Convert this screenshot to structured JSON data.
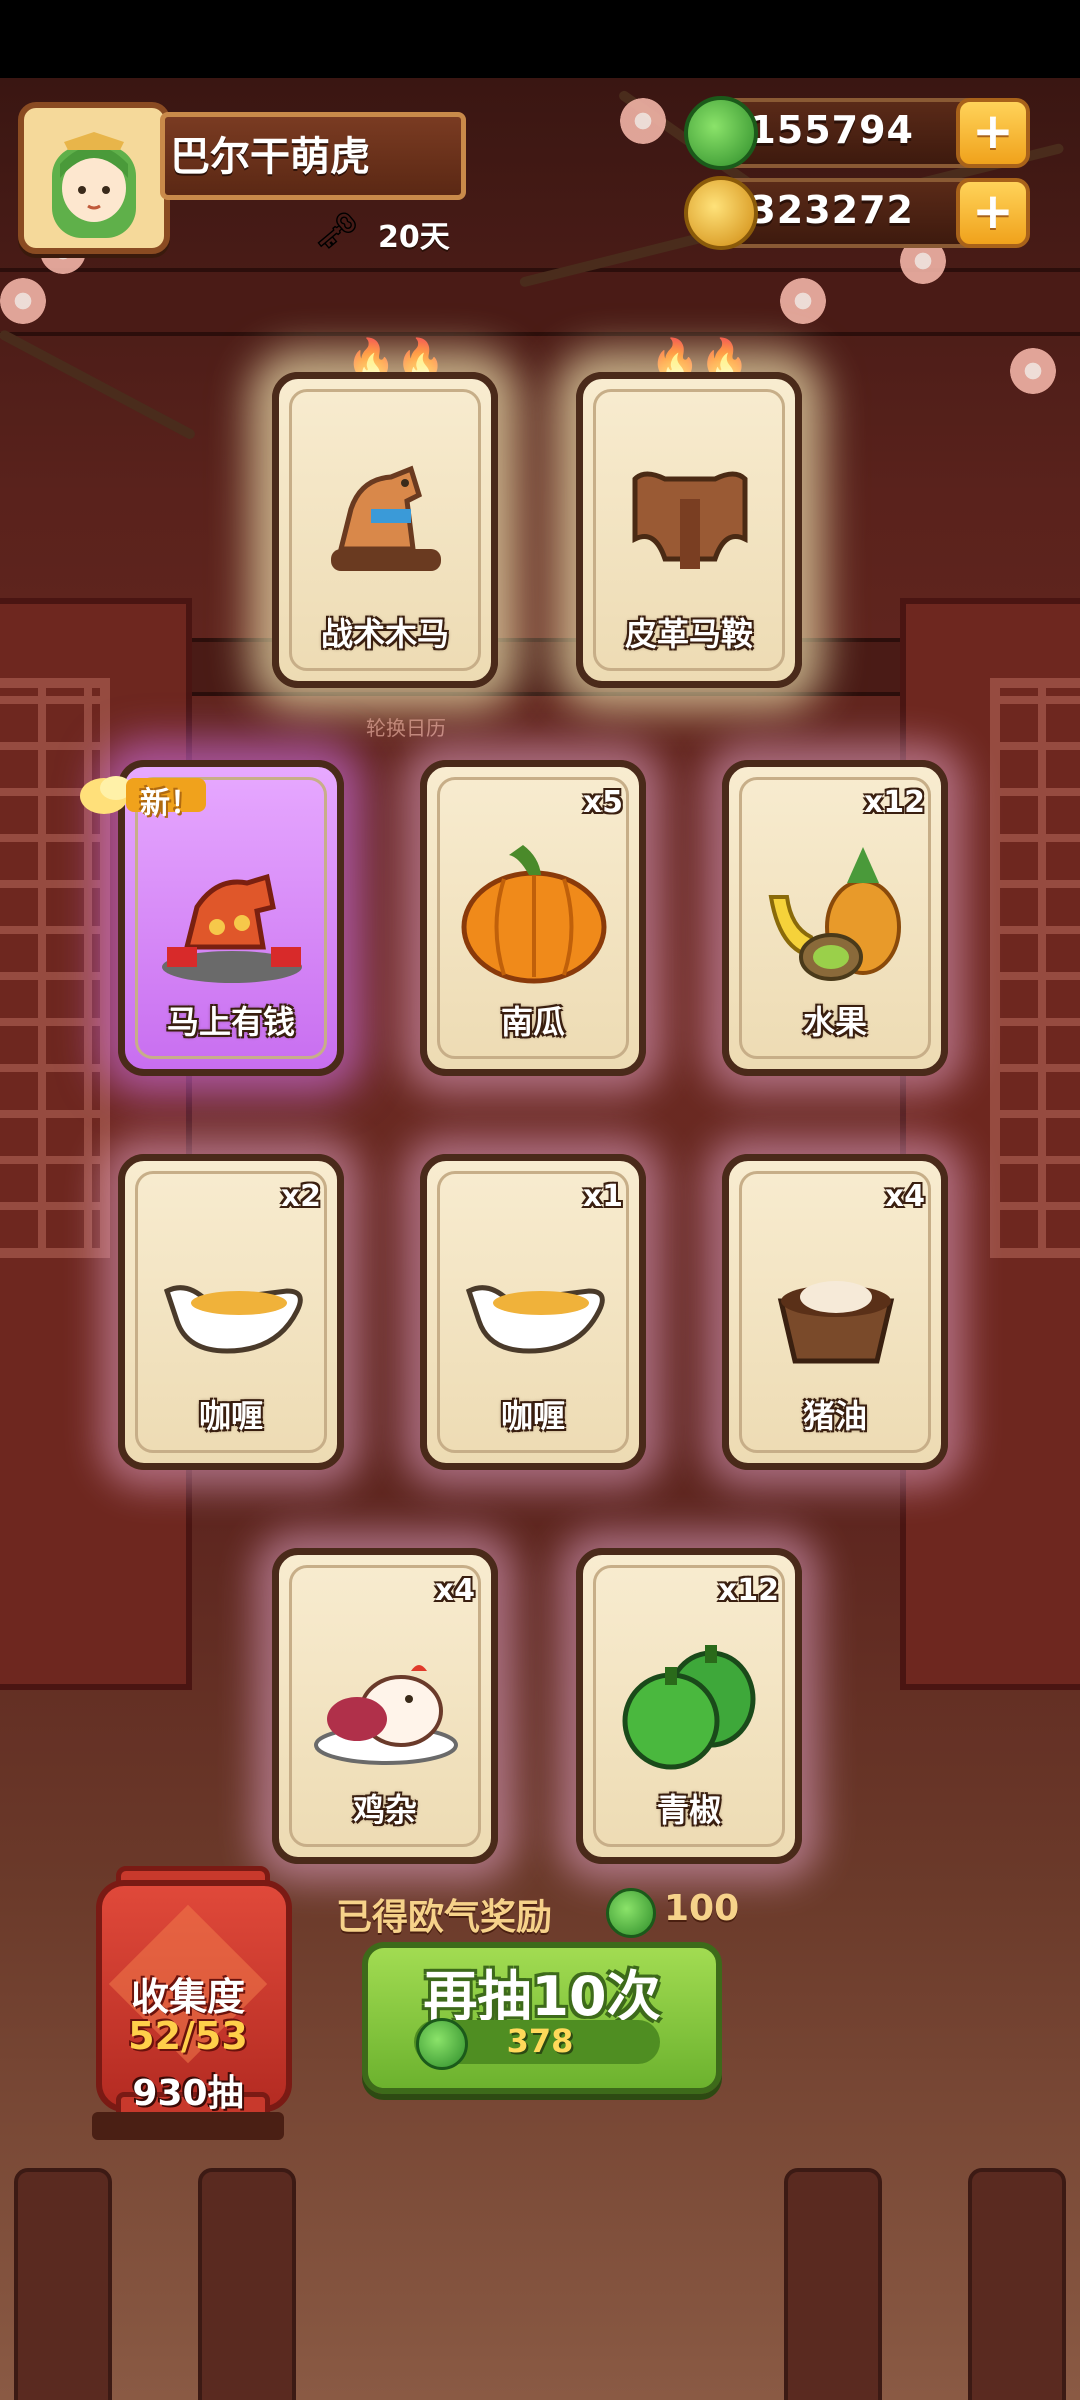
{
  "player": {
    "name": "巴尔干萌虎",
    "days": "20天"
  },
  "currencies": {
    "jade": "155794",
    "coins": "10323272"
  },
  "banner_label": "轮换日历",
  "cards": [
    {
      "name": "战术木马",
      "count": "",
      "rarity": "hot"
    },
    {
      "name": "皮革马鞍",
      "count": "",
      "rarity": "hot"
    },
    {
      "name": "马上有钱",
      "count": "",
      "rarity": "new"
    },
    {
      "name": "南瓜",
      "count": "x5"
    },
    {
      "name": "水果",
      "count": "x12"
    },
    {
      "name": "咖喱",
      "count": "x2"
    },
    {
      "name": "咖喱",
      "count": "x1"
    },
    {
      "name": "猪油",
      "count": "x4"
    },
    {
      "name": "鸡杂",
      "count": "x4"
    },
    {
      "name": "青椒",
      "count": "x12"
    }
  ],
  "new_badge": "新！",
  "collection": {
    "title": "收集度",
    "progress": "52/53",
    "draws": "930抽"
  },
  "reward": {
    "label": "已得欧气奖励",
    "value": "100"
  },
  "draw_button": {
    "label": "再抽10次",
    "cost": "378"
  },
  "colors": {
    "accent_green": "#6cb22e",
    "gold": "#f0a21c",
    "bg_red": "#5a221c"
  }
}
